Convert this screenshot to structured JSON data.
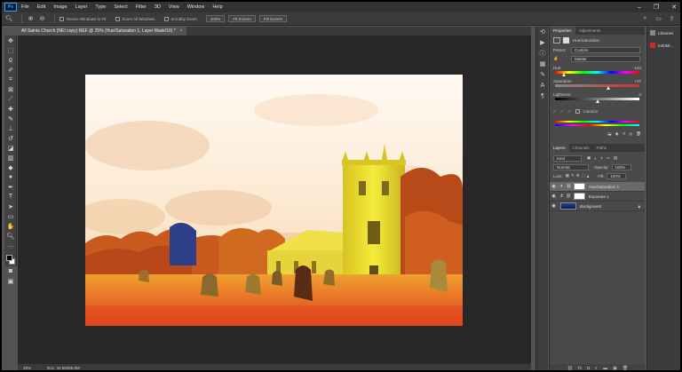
{
  "app": {
    "logo": "Ps"
  },
  "menu": [
    "File",
    "Edit",
    "Image",
    "Layer",
    "Type",
    "Select",
    "Filter",
    "3D",
    "View",
    "Window",
    "Help"
  ],
  "window_controls": [
    "–",
    "❐",
    "✕"
  ],
  "options_bar": {
    "resize_windows_label": "Resize Windows to Fit",
    "zoom_all_label": "Zoom All Windows",
    "scrubby_zoom_label": "Scrubby Zoom",
    "percent_btn": "100%",
    "fit_screen_btn": "Fit Screen",
    "fill_screen_btn": "Fill Screen"
  },
  "document_tab": {
    "title": "All Saints Church (NEI copy).NEF @ 25% (Hue/Saturation 1, Layer Mask/16) *",
    "close": "×"
  },
  "status_bar": {
    "zoom": "25%",
    "doc_info": "Doc: 34.9M/69.8M"
  },
  "properties": {
    "tab_properties": "Properties",
    "tab_adjustments": "Adjustments",
    "adj_title": "Hue/Saturation",
    "preset_label": "Preset:",
    "preset_value": "Custom",
    "channel_value": "Master",
    "hue_label": "Hue:",
    "hue_value": "-144",
    "saturation_label": "Saturation:",
    "saturation_value": "+27",
    "lightness_label": "Lightness:",
    "lightness_value": "0",
    "colorize_label": "Colorize",
    "hue_level": 0.1,
    "saturation_level": 0.63,
    "lightness_level": 0.5
  },
  "layers": {
    "tab_layers": "Layers",
    "tab_channels": "Channels",
    "tab_paths": "Paths",
    "kind_label": "Kind",
    "blend_mode": "Normal",
    "opacity_label": "Opacity:",
    "opacity_value": "100%",
    "lock_label": "Lock:",
    "fill_label": "Fill:",
    "fill_value": "100%",
    "items": [
      {
        "name": "Hue/Saturation 1"
      },
      {
        "name": "Exposure 1"
      },
      {
        "name": "Background"
      }
    ],
    "bottom_icons": [
      "ⓕ",
      "fx",
      "◐",
      "▤",
      "▣",
      "✎",
      "🗑"
    ]
  },
  "libraries": {
    "items": [
      "Libraries",
      "ImfoMi…"
    ],
    "colors": [
      "#888888",
      "#cc2a2a"
    ]
  },
  "colors": {
    "fg": "#000000",
    "bg": "#ffffff",
    "accent": "#31a8ff"
  }
}
